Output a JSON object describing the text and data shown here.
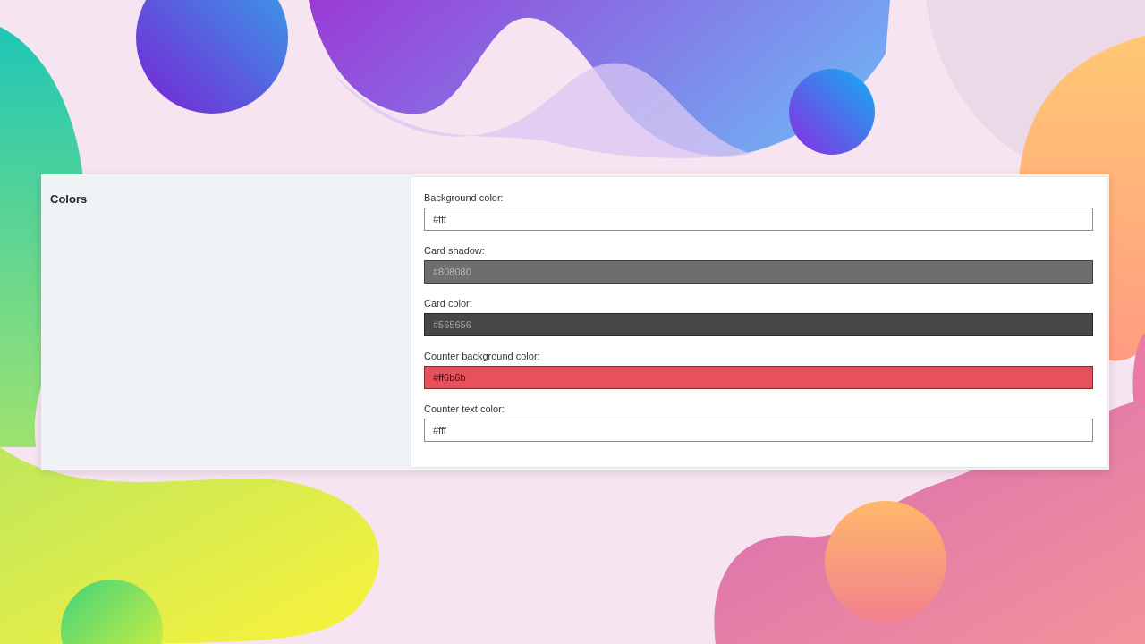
{
  "section": {
    "title": "Colors"
  },
  "fields": [
    {
      "label": "Background color:",
      "value": "#fff",
      "color": "#ffffff"
    },
    {
      "label": "Card shadow:",
      "value": "#808080",
      "color": "#6e6e6e"
    },
    {
      "label": "Card color:",
      "value": "#565656",
      "color": "#474747"
    },
    {
      "label": "Counter background color:",
      "value": "#ff6b6b",
      "color": "#e8505b"
    },
    {
      "label": "Counter text color:",
      "value": "#fff",
      "color": "#ffffff"
    }
  ]
}
